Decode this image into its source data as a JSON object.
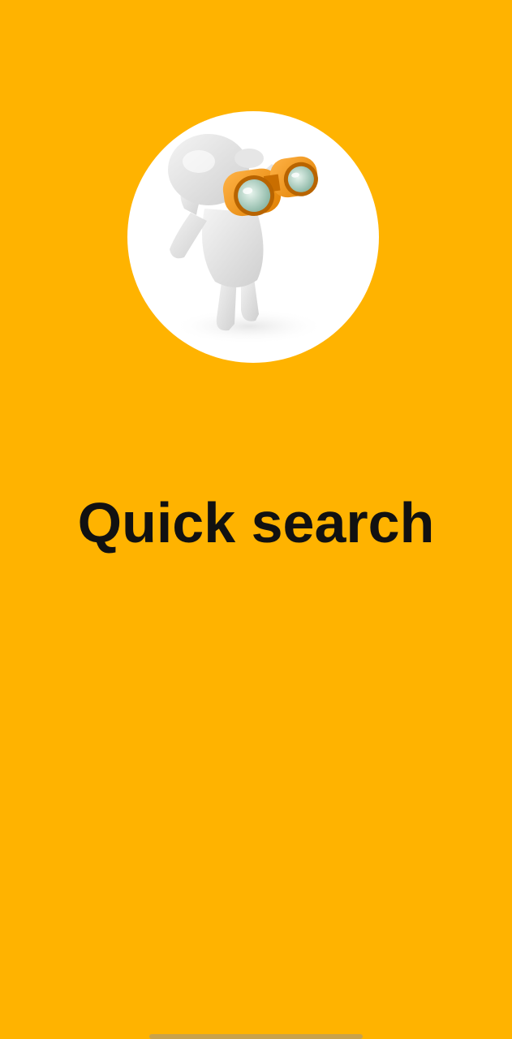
{
  "onboarding": {
    "title": "Quick search",
    "illustration_icon": "binoculars-figure-icon"
  },
  "colors": {
    "background": "#FFB300",
    "circle": "#FFFFFF",
    "binoculars": "#F59A1B",
    "title_text": "#111111"
  }
}
